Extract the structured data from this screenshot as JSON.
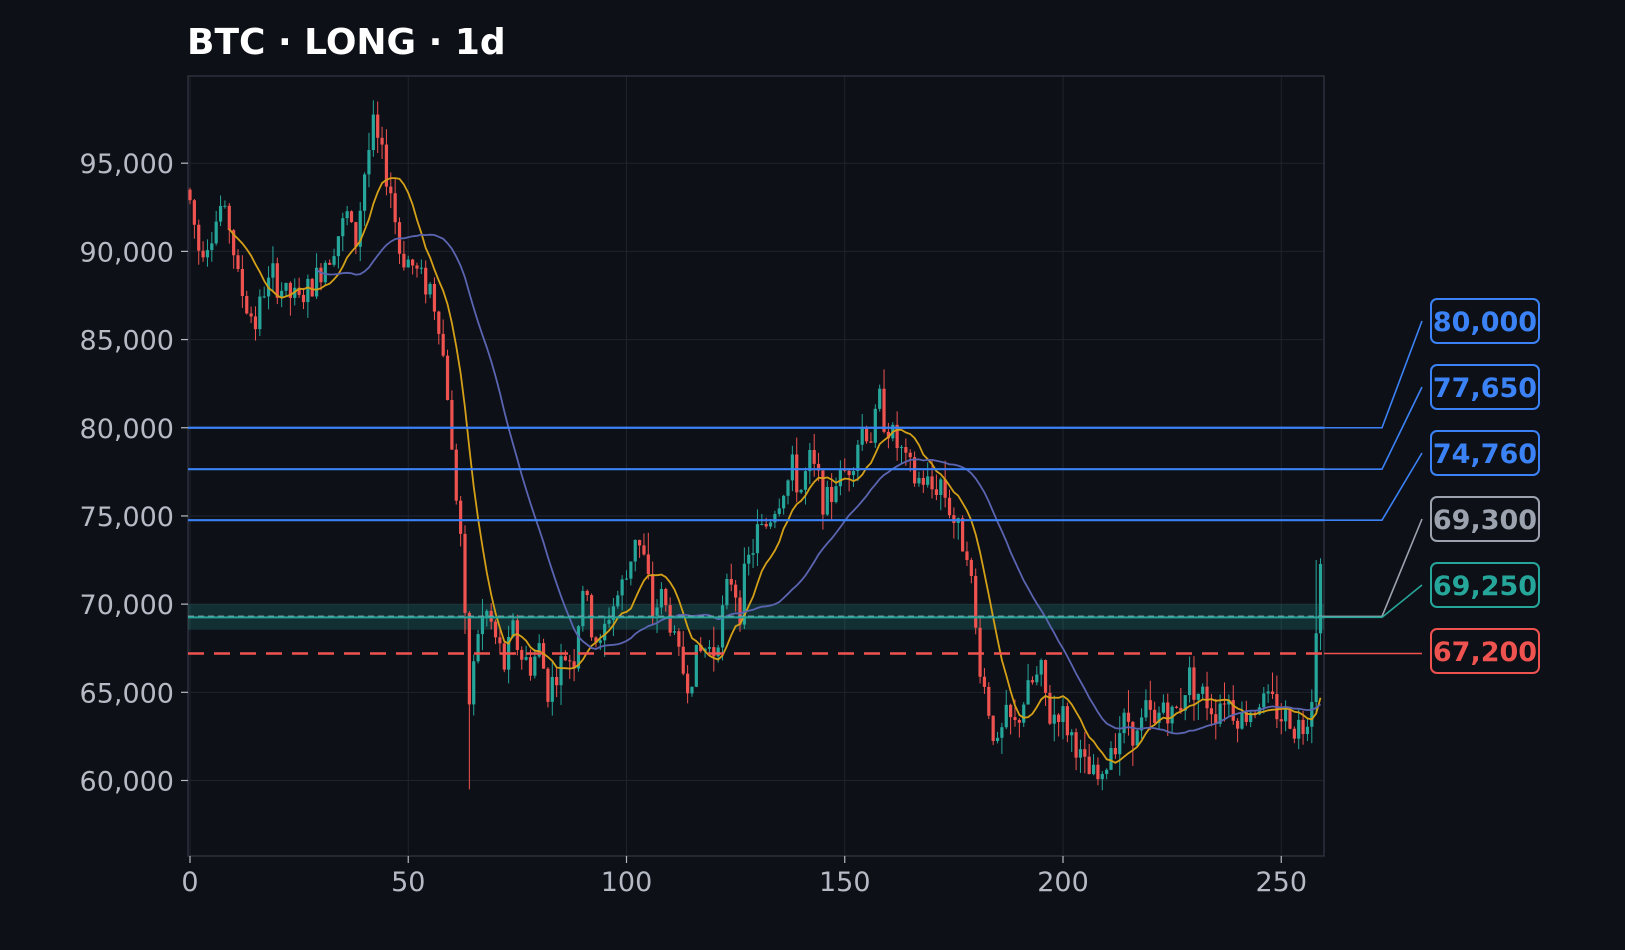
{
  "chart_data": {
    "type": "candlestick",
    "title": "BTC · LONG · 1d",
    "xlim": [
      -0.5,
      259.5
    ],
    "ylim": [
      55800,
      99800
    ],
    "x_ticks": [
      0,
      50,
      100,
      150,
      200,
      250
    ],
    "y_ticks": [
      60000,
      65000,
      70000,
      75000,
      80000,
      85000,
      90000,
      95000
    ],
    "y_tick_labels": [
      "60,000",
      "65,000",
      "70,000",
      "75,000",
      "80,000",
      "85,000",
      "90,000",
      "95,000"
    ],
    "grid": true,
    "close_path": [
      [
        0,
        92800
      ],
      [
        2,
        90200
      ],
      [
        5,
        91000
      ],
      [
        7,
        92500
      ],
      [
        9,
        91500
      ],
      [
        11,
        88500
      ],
      [
        13,
        86800
      ],
      [
        15,
        86000
      ],
      [
        17,
        87800
      ],
      [
        19,
        88500
      ],
      [
        22,
        87600
      ],
      [
        25,
        87200
      ],
      [
        28,
        88000
      ],
      [
        30,
        89000
      ],
      [
        33,
        90500
      ],
      [
        36,
        92000
      ],
      [
        38,
        90500
      ],
      [
        40,
        94500
      ],
      [
        42,
        97000
      ],
      [
        44,
        95200
      ],
      [
        46,
        93500
      ],
      [
        48,
        90000
      ],
      [
        50,
        89500
      ],
      [
        53,
        88500
      ],
      [
        55,
        88000
      ],
      [
        57,
        86000
      ],
      [
        59,
        82000
      ],
      [
        60,
        78500
      ],
      [
        62,
        74000
      ],
      [
        63,
        68500
      ],
      [
        64,
        64500
      ],
      [
        66,
        68500
      ],
      [
        68,
        69500
      ],
      [
        70,
        68000
      ],
      [
        72,
        66500
      ],
      [
        74,
        68500
      ],
      [
        76,
        67000
      ],
      [
        78,
        66500
      ],
      [
        80,
        67500
      ],
      [
        82,
        65200
      ],
      [
        84,
        66000
      ],
      [
        86,
        67000
      ],
      [
        88,
        67000
      ],
      [
        90,
        71000
      ],
      [
        92,
        68500
      ],
      [
        94,
        67500
      ],
      [
        96,
        69500
      ],
      [
        98,
        70500
      ],
      [
        100,
        71500
      ],
      [
        102,
        74000
      ],
      [
        104,
        72500
      ],
      [
        106,
        69500
      ],
      [
        108,
        70500
      ],
      [
        110,
        69000
      ],
      [
        112,
        67000
      ],
      [
        114,
        65500
      ],
      [
        116,
        67000
      ],
      [
        118,
        67500
      ],
      [
        120,
        67500
      ],
      [
        122,
        69500
      ],
      [
        124,
        71500
      ],
      [
        126,
        70000
      ],
      [
        128,
        72500
      ],
      [
        130,
        74000
      ],
      [
        132,
        74500
      ],
      [
        134,
        75500
      ],
      [
        136,
        76500
      ],
      [
        138,
        77500
      ],
      [
        140,
        76500
      ],
      [
        142,
        78000
      ],
      [
        144,
        77000
      ],
      [
        146,
        75500
      ],
      [
        148,
        77000
      ],
      [
        150,
        77500
      ],
      [
        152,
        78500
      ],
      [
        154,
        80000
      ],
      [
        156,
        79500
      ],
      [
        158,
        81500
      ],
      [
        160,
        80000
      ],
      [
        162,
        79000
      ],
      [
        164,
        78000
      ],
      [
        166,
        77000
      ],
      [
        168,
        77000
      ],
      [
        170,
        76500
      ],
      [
        172,
        77000
      ],
      [
        174,
        75500
      ],
      [
        176,
        74000
      ],
      [
        178,
        73500
      ],
      [
        180,
        68500
      ],
      [
        181,
        66500
      ],
      [
        183,
        64000
      ],
      [
        185,
        61800
      ],
      [
        187,
        63500
      ],
      [
        189,
        63000
      ],
      [
        191,
        64500
      ],
      [
        193,
        65500
      ],
      [
        195,
        66000
      ],
      [
        197,
        63500
      ],
      [
        199,
        64000
      ],
      [
        201,
        63000
      ],
      [
        203,
        62000
      ],
      [
        205,
        60500
      ],
      [
        207,
        60200
      ],
      [
        209,
        59800
      ],
      [
        211,
        62000
      ],
      [
        213,
        63000
      ],
      [
        215,
        63500
      ],
      [
        217,
        62500
      ],
      [
        219,
        64000
      ],
      [
        221,
        63000
      ],
      [
        223,
        64500
      ],
      [
        225,
        63500
      ],
      [
        227,
        64500
      ],
      [
        229,
        66000
      ],
      [
        231,
        65000
      ],
      [
        233,
        64500
      ],
      [
        235,
        64000
      ],
      [
        237,
        65000
      ],
      [
        239,
        64000
      ],
      [
        241,
        63500
      ],
      [
        243,
        64000
      ],
      [
        245,
        64500
      ],
      [
        247,
        64500
      ],
      [
        249,
        64000
      ],
      [
        251,
        63500
      ],
      [
        253,
        63200
      ],
      [
        255,
        63000
      ],
      [
        256,
        64000
      ],
      [
        257,
        65000
      ],
      [
        258,
        69000
      ],
      [
        259,
        72000
      ]
    ],
    "levels": [
      {
        "label": "80,000",
        "value": 80000,
        "color": "#3b82f6",
        "style": "solid"
      },
      {
        "label": "77,650",
        "value": 77650,
        "color": "#3b82f6",
        "style": "solid"
      },
      {
        "label": "74,760",
        "value": 74760,
        "color": "#3b82f6",
        "style": "solid"
      },
      {
        "label": "69,300",
        "value": 69300,
        "color": "#9ca3af",
        "style": "dashed"
      },
      {
        "label": "69,250",
        "value": 69250,
        "color": "#26a69a",
        "style": "zone"
      },
      {
        "label": "67,200",
        "value": 67200,
        "color": "#ef5350",
        "style": "dashed"
      }
    ],
    "entry_zone": [
      68550,
      70000
    ],
    "moving_averages": [
      {
        "period": 10,
        "color": "#d4a017"
      },
      {
        "period": 30,
        "color": "#5a64b0"
      }
    ]
  },
  "colors": {
    "background": "#0d1017",
    "grid": "#1e232c",
    "frame": "#2c313b",
    "up": "#26a69a",
    "down": "#ef5350",
    "tick_text": "#b5bac4",
    "title": "#ffffff"
  }
}
